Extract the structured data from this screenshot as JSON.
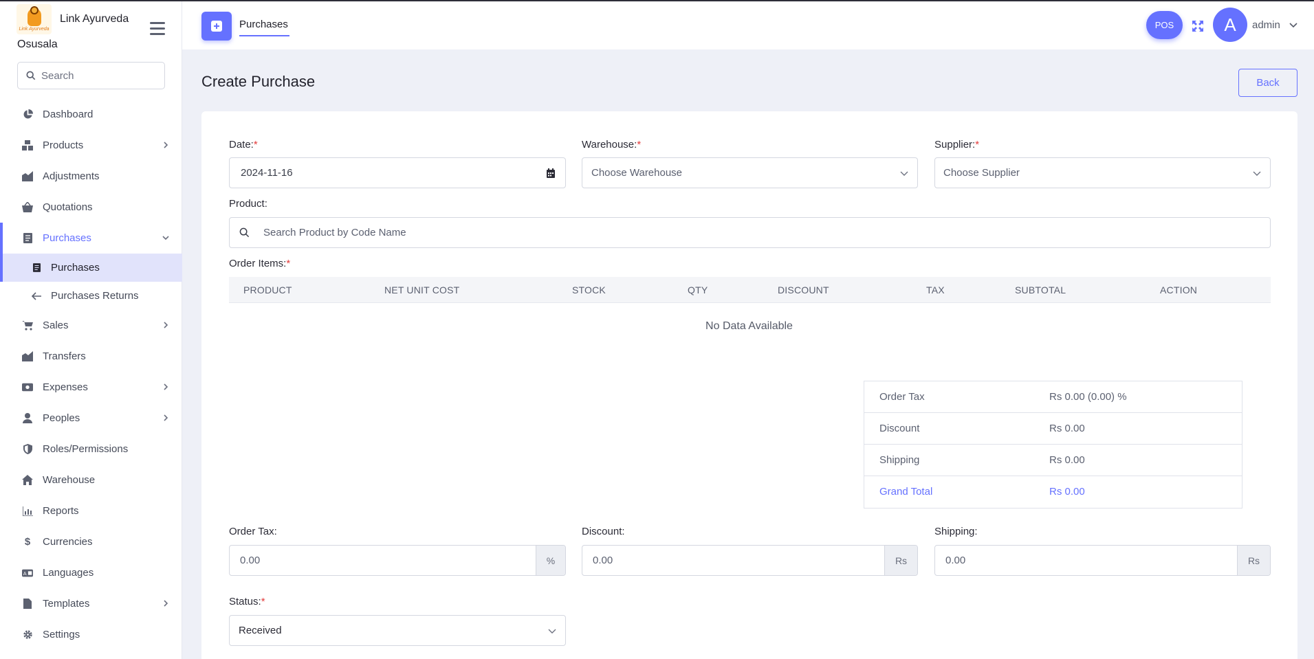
{
  "app": {
    "brand_line1": "Link Ayurveda",
    "brand_line2": "Osusala",
    "logo_text": "Link Ayurveda"
  },
  "sidebar": {
    "search_placeholder": "Search",
    "items": [
      {
        "label": "Dashboard",
        "icon": "pie-chart-icon"
      },
      {
        "label": "Products",
        "icon": "boxes-icon",
        "has_children": true
      },
      {
        "label": "Adjustments",
        "icon": "adjust-icon"
      },
      {
        "label": "Quotations",
        "icon": "basket-icon"
      },
      {
        "label": "Purchases",
        "icon": "receipt-icon",
        "expanded": true,
        "active": true
      },
      {
        "label": "Sales",
        "icon": "cart-icon",
        "has_children": true
      },
      {
        "label": "Transfers",
        "icon": "map-icon"
      },
      {
        "label": "Expenses",
        "icon": "money-icon",
        "has_children": true
      },
      {
        "label": "Peoples",
        "icon": "user-icon",
        "has_children": true
      },
      {
        "label": "Roles/Permissions",
        "icon": "shield-icon"
      },
      {
        "label": "Warehouse",
        "icon": "home-icon"
      },
      {
        "label": "Reports",
        "icon": "bar-chart-icon"
      },
      {
        "label": "Currencies",
        "icon": "dollar-icon"
      },
      {
        "label": "Languages",
        "icon": "language-icon"
      },
      {
        "label": "Templates",
        "icon": "file-icon",
        "has_children": true
      },
      {
        "label": "Settings",
        "icon": "gear-icon"
      }
    ],
    "purchases_sub": [
      {
        "label": "Purchases",
        "selected": true
      },
      {
        "label": "Purchases Returns"
      }
    ]
  },
  "header": {
    "tab_label": "Purchases",
    "pos_label": "POS",
    "avatar_letter": "A",
    "user_name": "admin"
  },
  "page": {
    "title": "Create Purchase",
    "back_label": "Back"
  },
  "form": {
    "date_label": "Date:",
    "date_value": "2024-11-16",
    "warehouse_label": "Warehouse:",
    "warehouse_placeholder": "Choose Warehouse",
    "supplier_label": "Supplier:",
    "supplier_placeholder": "Choose Supplier",
    "product_label": "Product:",
    "product_placeholder": "Search Product by Code Name",
    "order_items_label": "Order Items:",
    "required_mark": "*",
    "columns": [
      "PRODUCT",
      "NET UNIT COST",
      "STOCK",
      "QTY",
      "DISCOUNT",
      "TAX",
      "SUBTOTAL",
      "ACTION"
    ],
    "empty_text": "No Data Available",
    "order_tax_label": "Order Tax:",
    "order_tax_value": "0.00",
    "order_tax_unit": "%",
    "discount_label": "Discount:",
    "discount_value": "0.00",
    "discount_unit": "Rs",
    "shipping_label": "Shipping:",
    "shipping_value": "0.00",
    "shipping_unit": "Rs",
    "status_label": "Status:",
    "status_value": "Received"
  },
  "summary": [
    {
      "key": "Order Tax",
      "value": "Rs 0.00 (0.00) %"
    },
    {
      "key": "Discount",
      "value": "Rs 0.00"
    },
    {
      "key": "Shipping",
      "value": "Rs 0.00"
    },
    {
      "key": "Grand Total",
      "value": "Rs 0.00"
    }
  ],
  "colors": {
    "accent": "#6571ff",
    "required": "#e33b3b",
    "page_bg": "#eef0f7"
  }
}
